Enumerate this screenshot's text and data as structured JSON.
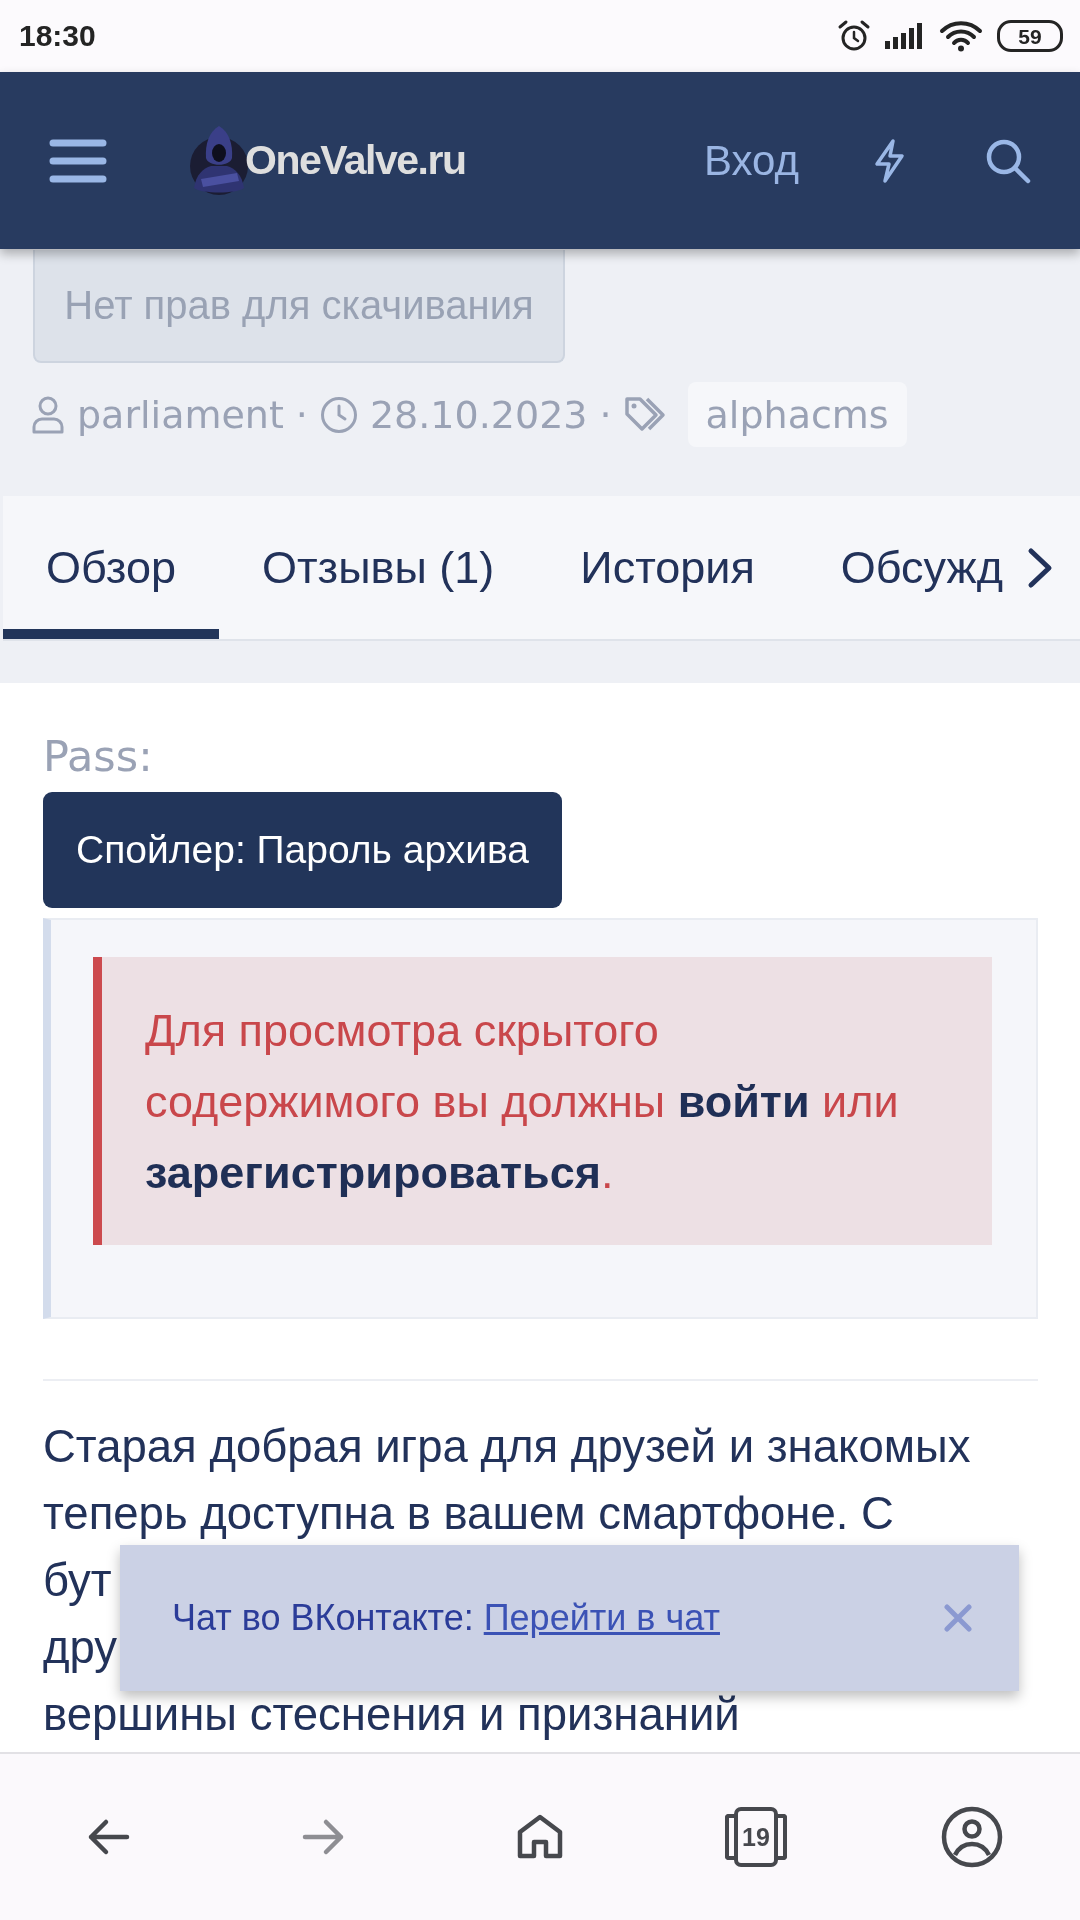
{
  "status_bar": {
    "time": "18:30",
    "battery": "59"
  },
  "header": {
    "logo": "OneValve.ru",
    "login": "Вход"
  },
  "download_button": {
    "label": "Нет прав для скачивания",
    "disabled": true
  },
  "meta": [
    {
      "kind": "author",
      "text": "parliament"
    },
    {
      "kind": "separator",
      "text": "·"
    },
    {
      "kind": "date",
      "text": "28.10.2023"
    },
    {
      "kind": "separator",
      "text": "·"
    },
    {
      "kind": "tags",
      "tags": [
        "alphacms"
      ]
    }
  ],
  "tabs": [
    {
      "label": "Обзор",
      "selected": true
    },
    {
      "label": "Отзывы (1)",
      "selected": false
    },
    {
      "label": "История",
      "selected": false
    },
    {
      "label": "Обсужд",
      "selected": false
    }
  ],
  "content": {
    "pass_label": "Pass:",
    "spoiler_button": "Спойлер: Пароль архива",
    "notice": [
      {
        "kind": "text",
        "text": "Для просмотра скрытого содержимого вы должны "
      },
      {
        "kind": "link",
        "text": "войти"
      },
      {
        "kind": "text",
        "text": " или "
      },
      {
        "kind": "link",
        "text": "зарегистрироваться"
      },
      {
        "kind": "text",
        "text": "."
      }
    ],
    "paragraph_lines": [
      "Старая добрая игра для друзей и знакомых",
      "теперь доступна в вашем смартфоне. С",
      "бут",
      "дру",
      "вершины стеснения и признаний"
    ]
  },
  "chat_toast": {
    "text": "Чат во ВКонтакте:",
    "link": "Перейти в чат"
  },
  "bottom_nav": [
    {
      "kind": "back",
      "disabled": false
    },
    {
      "kind": "forward",
      "disabled": true
    },
    {
      "kind": "home",
      "disabled": false
    },
    {
      "kind": "tabs",
      "count": "19",
      "disabled": false
    },
    {
      "kind": "profile",
      "disabled": false
    }
  ]
}
